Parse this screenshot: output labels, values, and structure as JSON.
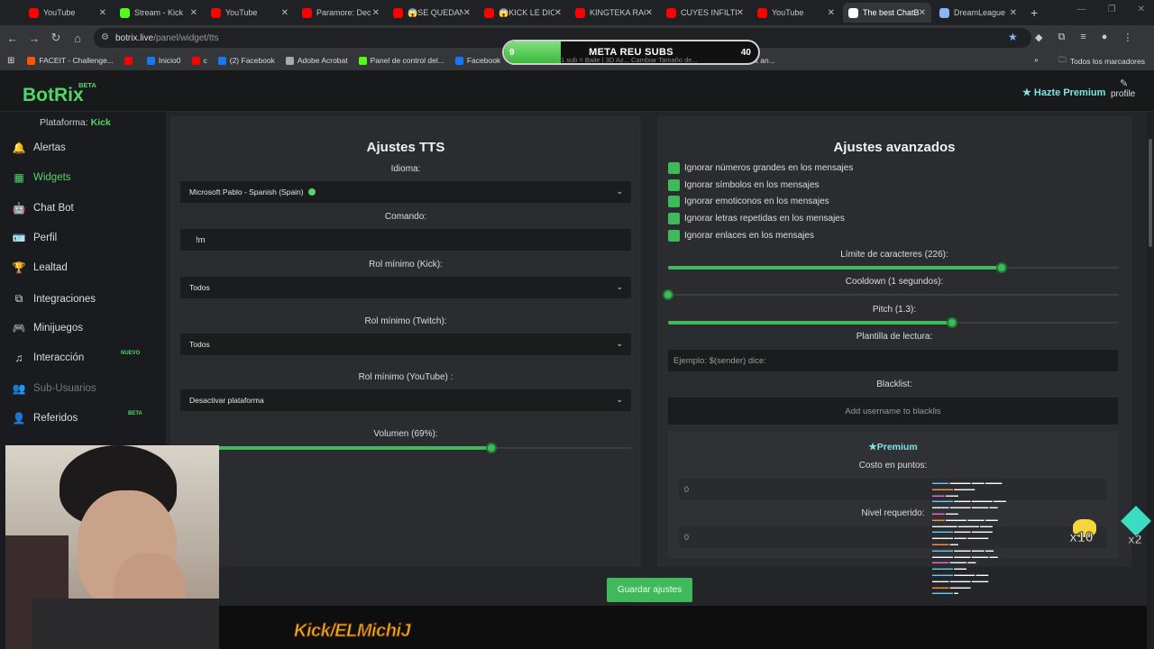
{
  "browser": {
    "tabs": [
      {
        "label": "YouTube",
        "color": "#ff0000"
      },
      {
        "label": "Stream - Kick",
        "color": "#53fc18"
      },
      {
        "label": "YouTube",
        "color": "#ff0000"
      },
      {
        "label": "Paramore: Dec",
        "color": "#ff0000"
      },
      {
        "label": "😱SE QUEDAN",
        "color": "#ff0000"
      },
      {
        "label": "😱KICK LE DIO",
        "color": "#ff0000"
      },
      {
        "label": "KINGTEKA RAG",
        "color": "#ff0000"
      },
      {
        "label": "CUYES INFILTR",
        "color": "#ff0000"
      },
      {
        "label": "YouTube",
        "color": "#ff0000"
      },
      {
        "label": "The best ChatB",
        "color": "#ffffff",
        "active": true
      },
      {
        "label": "DreamLeague",
        "color": "#8ab4f8"
      }
    ],
    "new_tab": "+",
    "url_host": "botrix.live",
    "url_path": "/panel/widget/tts",
    "bookmarks": [
      {
        "label": "FACEIT - Challenge...",
        "color": "#ff5500"
      },
      {
        "label": "",
        "color": "#ff0000"
      },
      {
        "label": "Inicio0",
        "color": "#1877f2"
      },
      {
        "label": "c",
        "color": "#ff0000"
      },
      {
        "label": "(2) Facebook",
        "color": "#1877f2"
      },
      {
        "label": "Adobe Acrobat",
        "color": "#aaaaaa"
      },
      {
        "label": "Panel de control del...",
        "color": "#53fc18"
      },
      {
        "label": "Facebook",
        "color": "#1877f2"
      },
      {
        "label": "Generated Image",
        "color": "#aaaaaa"
      },
      {
        "label": "Dota 2 Streaming -...",
        "color": "#53fc18"
      },
      {
        "label": "The best ChatBot an...",
        "color": "#ffffff"
      }
    ],
    "all_bookmarks": "Todos los marcadores"
  },
  "goal": {
    "start": "9",
    "title": "META REU SUBS",
    "end": "40",
    "progress": 0.225,
    "subtext": "1 sub = Baile | 3D Az...   Cambiar Tamaño de..."
  },
  "header": {
    "logo": "BotRix",
    "logo_badge": "BETA",
    "premium": "★ Hazte Premium",
    "profile": "profile"
  },
  "sidebar": {
    "platform_label": "Plataforma:",
    "platform_value": "Kick",
    "items": [
      {
        "label": "Alertas",
        "icon": "bell-icon",
        "glyph": "🔔"
      },
      {
        "label": "Widgets",
        "icon": "grid-icon",
        "glyph": "▦"
      },
      {
        "label": "Chat Bot",
        "icon": "robot-icon",
        "glyph": "🤖"
      },
      {
        "label": "Perfil",
        "icon": "id-card-icon",
        "glyph": "🪪"
      },
      {
        "label": "Lealtad",
        "icon": "trophy-icon",
        "glyph": "🏆"
      },
      {
        "label": "Integraciones",
        "icon": "plug-icon",
        "glyph": "⧉"
      },
      {
        "label": "Minijuegos",
        "icon": "gamepad-icon",
        "glyph": "🎮"
      },
      {
        "label": "Interacción",
        "icon": "music-icon",
        "glyph": "♫"
      },
      {
        "label": "Sub-Usuarios",
        "icon": "users-icon",
        "glyph": "👥"
      },
      {
        "label": "Referidos",
        "icon": "referral-icon",
        "glyph": "👤"
      }
    ],
    "badge_new": "NUEVO",
    "badge_beta": "BETA"
  },
  "tts": {
    "title": "Ajustes TTS",
    "language_label": "Idioma:",
    "language_value": "Microsoft Pablo - Spanish (Spain)",
    "command_label": "Comando:",
    "command_value": "!m",
    "role_kick_label": "Rol mínimo (Kick):",
    "role_kick_value": "Todos",
    "role_twitch_label": "Rol mínimo (Twitch):",
    "role_twitch_value": "Todos",
    "role_youtube_label": "Rol mínimo (YouTube) :",
    "role_youtube_value": "Desactivar plataforma",
    "volume_label": "Volumen (69%):",
    "volume": 0.69
  },
  "advanced": {
    "title": "Ajustes avanzados",
    "checks": [
      "Ignorar números grandes en los mensajes",
      "Ignorar símbolos en los mensajes",
      "Ignorar emoticonos en los mensajes",
      "Ignorar letras repetidas en los mensajes",
      "Ignorar enlaces en los mensajes"
    ],
    "char_limit_label": "Límite de caracteres (226):",
    "char_limit_fraction": 0.74,
    "cooldown_label": "Cooldown (1 segundos):",
    "cooldown_fraction": 0.0,
    "pitch_label": "Pitch (1.3):",
    "pitch_fraction": 0.63,
    "template_label": "Plantilla de lectura:",
    "template_placeholder": "Ejemplo: $(sender) dice:",
    "blacklist_label": "Blacklist:",
    "blacklist_placeholder": "Add username to blacklis",
    "premium_title": "★Premium",
    "cost_label": "Costo en puntos:",
    "cost_value": "0",
    "level_label": "Nivel requerido:",
    "level_value": "0"
  },
  "save_button": "Guardar ajustes",
  "stream": {
    "kick_tag": "Kick/ELMichiJ",
    "x10": "x10",
    "x2": "x2"
  }
}
